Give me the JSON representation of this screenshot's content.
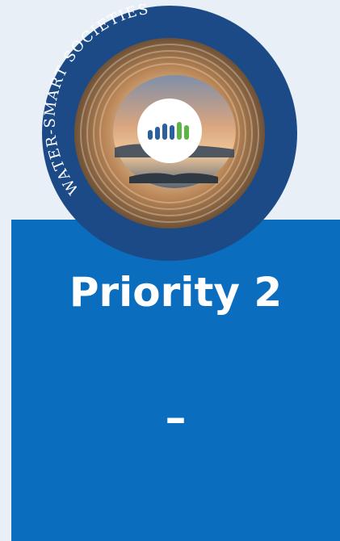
{
  "emblem": {
    "ring_text": "WATER-SMART SOCIETIES",
    "icon": "bar-chart-logo-icon",
    "colors": {
      "ring": "#1c4a86",
      "bars_blue": "#2a5fa0",
      "bars_green": "#5fb447"
    }
  },
  "panel": {
    "title": "Priority 2",
    "subtitle": "–",
    "color": "#0b6dbe"
  }
}
